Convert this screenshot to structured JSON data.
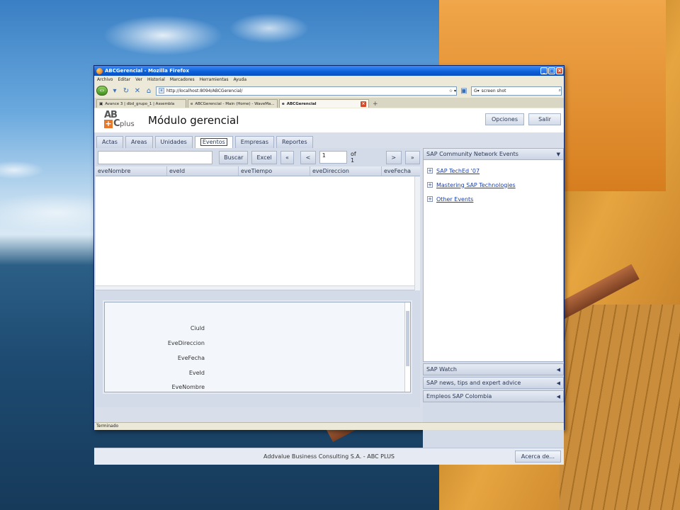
{
  "browser": {
    "window_title": "ABCGerencial - Mozilla Firefox",
    "menu": [
      "Archivo",
      "Editar",
      "Ver",
      "Historial",
      "Marcadores",
      "Herramientas",
      "Ayuda"
    ],
    "url": "http://localhost:8094/ABCGerencial/",
    "search_value": "screen shot",
    "tabs": [
      {
        "label": "Avance 3 | dbd_grupo_1 | Assembla"
      },
      {
        "label": "ABCGerencial - Main (Home) - WaveMa..."
      },
      {
        "label": "ABCGerencial"
      }
    ],
    "status": "Terminado"
  },
  "app": {
    "logo": {
      "ab": "AB",
      "plus": "+",
      "c": "C",
      "pl": "plus"
    },
    "title": "Módulo gerencial",
    "header_buttons": {
      "options": "Opciones",
      "exit": "Salir"
    },
    "tabs": [
      "Actas",
      "Areas",
      "Unidades",
      "Eventos",
      "Empresas",
      "Reportes"
    ],
    "active_tab": "Eventos",
    "toolbar": {
      "search_button": "Buscar",
      "excel_button": "Excel",
      "first": "«",
      "prev": "<",
      "page_value": "1",
      "of_label": "of 1",
      "next": ">",
      "last": "»"
    },
    "grid_columns": [
      "eveNombre",
      "eveId",
      "eveTiempo",
      "eveDireccion",
      "eveFecha"
    ],
    "detail_fields": [
      "Ciuld",
      "EveDireccion",
      "EveFecha",
      "EveId",
      "EveNombre"
    ],
    "side": {
      "top_panel": "SAP Community Network Events",
      "links": [
        "SAP TechEd '07",
        "Mastering SAP Technologies",
        "Other Events"
      ],
      "panels": [
        "SAP Watch",
        "SAP news, tips and expert advice",
        "Empleos SAP Colombia"
      ]
    },
    "footer_text": "Addvalue Business Consulting S.A. - ABC PLUS",
    "footer_button": "Acerca de..."
  }
}
